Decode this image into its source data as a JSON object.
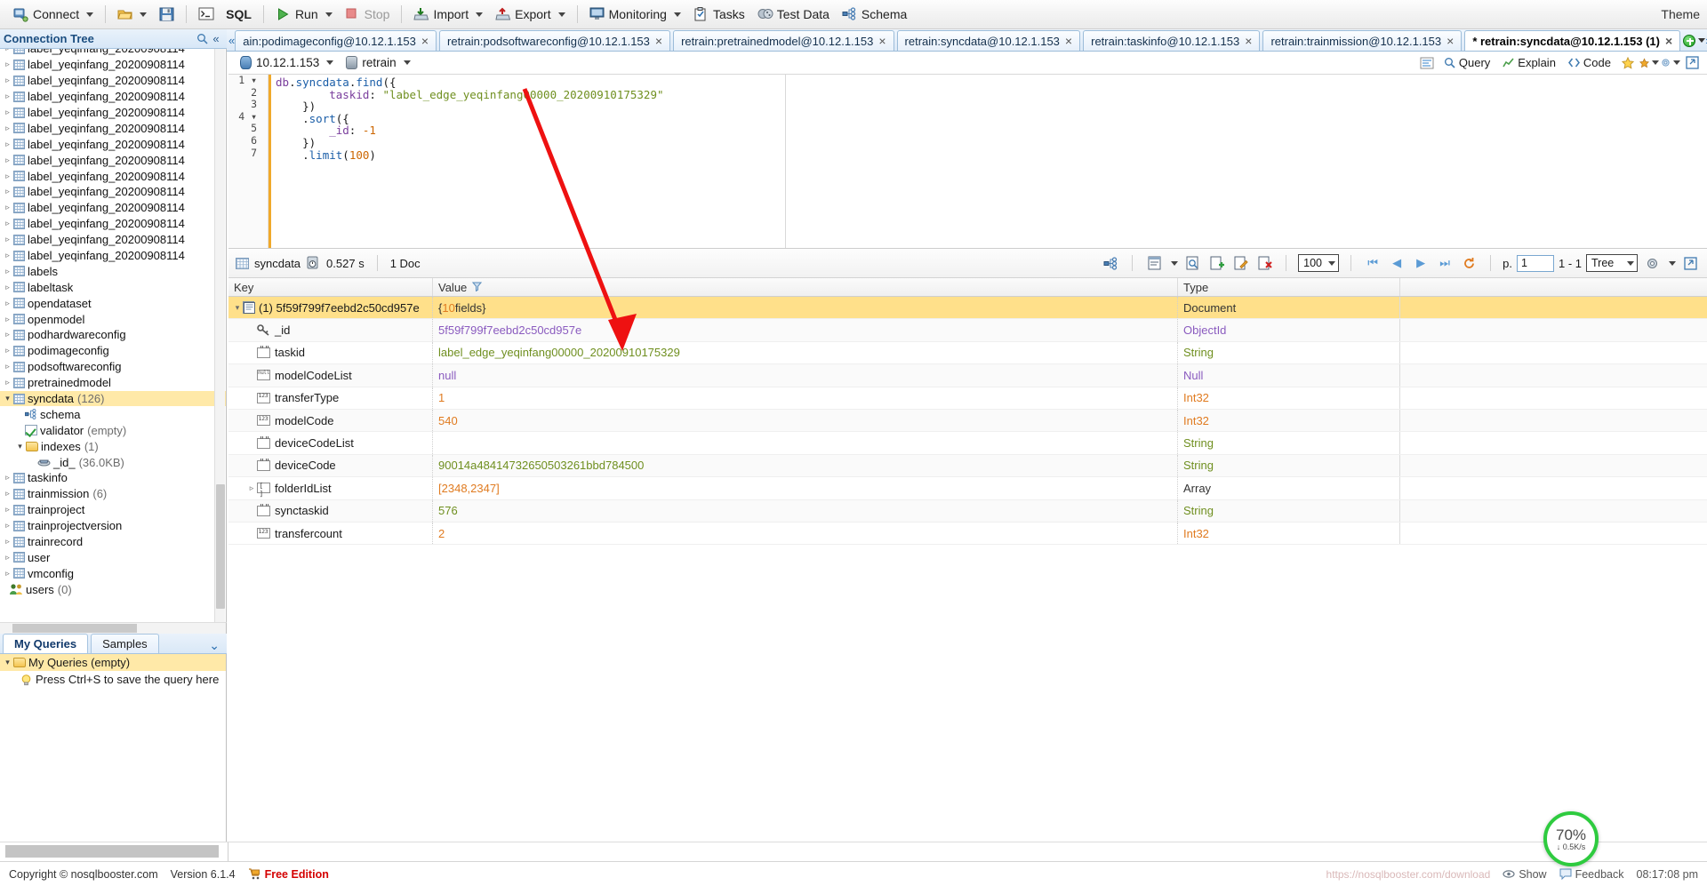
{
  "toolbar": {
    "connect": "Connect",
    "open_label": "",
    "save_label": "",
    "shell_label": "",
    "sql": "SQL",
    "run": "Run",
    "stop": "Stop",
    "import": "Import",
    "export": "Export",
    "monitoring": "Monitoring",
    "tasks": "Tasks",
    "test_data": "Test Data",
    "schema": "Schema",
    "theme": "Theme"
  },
  "sidebar": {
    "title": "Connection Tree",
    "collections": [
      {
        "label": "label_yeqinfang_20200908114",
        "count": "",
        "indent": 1
      },
      {
        "label": "label_yeqinfang_20200908114",
        "count": "",
        "indent": 1
      },
      {
        "label": "label_yeqinfang_20200908114",
        "count": "",
        "indent": 1
      },
      {
        "label": "label_yeqinfang_20200908114",
        "count": "",
        "indent": 1
      },
      {
        "label": "label_yeqinfang_20200908114",
        "count": "",
        "indent": 1
      },
      {
        "label": "label_yeqinfang_20200908114",
        "count": "",
        "indent": 1
      },
      {
        "label": "label_yeqinfang_20200908114",
        "count": "",
        "indent": 1
      },
      {
        "label": "label_yeqinfang_20200908114",
        "count": "",
        "indent": 1
      },
      {
        "label": "label_yeqinfang_20200908114",
        "count": "",
        "indent": 1
      },
      {
        "label": "label_yeqinfang_20200908114",
        "count": "",
        "indent": 1
      },
      {
        "label": "label_yeqinfang_20200908114",
        "count": "",
        "indent": 1
      },
      {
        "label": "label_yeqinfang_20200908114",
        "count": "",
        "indent": 1
      },
      {
        "label": "label_yeqinfang_20200908114",
        "count": "",
        "indent": 1
      },
      {
        "label": "label_yeqinfang_20200908114",
        "count": "",
        "indent": 1
      },
      {
        "label": "labels",
        "count": "",
        "indent": 1
      },
      {
        "label": "labeltask",
        "count": "",
        "indent": 1
      },
      {
        "label": "opendataset",
        "count": "",
        "indent": 1
      },
      {
        "label": "openmodel",
        "count": "",
        "indent": 1
      },
      {
        "label": "podhardwareconfig",
        "count": "",
        "indent": 1
      },
      {
        "label": "podimageconfig",
        "count": "",
        "indent": 1
      },
      {
        "label": "podsoftwareconfig",
        "count": "",
        "indent": 1
      },
      {
        "label": "pretrainedmodel",
        "count": "",
        "indent": 1
      }
    ],
    "selected": {
      "label": "syncdata",
      "count": "(126)"
    },
    "selected_children": [
      {
        "label": "schema",
        "count": "",
        "icon": "schema-icon"
      },
      {
        "label": "validator",
        "count": "(empty)",
        "icon": "validator-icon"
      },
      {
        "label": "indexes",
        "count": "(1)",
        "icon": "folder-icon"
      },
      {
        "label": "_id_",
        "count": "(36.0KB)",
        "icon": "index-icon"
      }
    ],
    "collections_after": [
      {
        "label": "taskinfo",
        "count": ""
      },
      {
        "label": "trainmission",
        "count": "(6)"
      },
      {
        "label": "trainproject",
        "count": ""
      },
      {
        "label": "trainprojectversion",
        "count": ""
      },
      {
        "label": "trainrecord",
        "count": ""
      },
      {
        "label": "user",
        "count": ""
      },
      {
        "label": "vmconfig",
        "count": ""
      }
    ],
    "users_node": {
      "label": "users",
      "count": "(0)"
    }
  },
  "my_queries": {
    "tabs": [
      "My Queries",
      "Samples"
    ],
    "active_tab": "My Queries",
    "root": "My Queries (empty)",
    "hint": "Press Ctrl+S to save the query here"
  },
  "editor_tabs": {
    "items": [
      {
        "label": "ain:podimageconfig@10.12.1.153",
        "active": false
      },
      {
        "label": "retrain:podsoftwareconfig@10.12.1.153",
        "active": false
      },
      {
        "label": "retrain:pretrainedmodel@10.12.1.153",
        "active": false
      },
      {
        "label": "retrain:syncdata@10.12.1.153",
        "active": false
      },
      {
        "label": "retrain:taskinfo@10.12.1.153",
        "active": false
      },
      {
        "label": "retrain:trainmission@10.12.1.153",
        "active": false
      },
      {
        "label": "* retrain:syncdata@10.12.1.153 (1)",
        "active": true
      }
    ]
  },
  "context_bar": {
    "host": "10.12.1.153",
    "database": "retrain",
    "query": "Query",
    "explain": "Explain",
    "code": "Code"
  },
  "code": {
    "lines": [
      {
        "n": "1",
        "fold": "▾",
        "text": "db.syncdata.find({"
      },
      {
        "n": "2",
        "fold": "",
        "text": "        taskid: \"label_edge_yeqinfang00000_20200910175329\""
      },
      {
        "n": "3",
        "fold": "",
        "text": "    })"
      },
      {
        "n": "4",
        "fold": "▾",
        "text": "    .sort({"
      },
      {
        "n": "5",
        "fold": "",
        "text": "        _id: -1"
      },
      {
        "n": "6",
        "fold": "",
        "text": "    })"
      },
      {
        "n": "7",
        "fold": "",
        "text": "    .limit(100)"
      }
    ],
    "taskid_value": "label_edge_yeqinfang00000_20200910175329",
    "sort_value": "-1",
    "limit_value": "100"
  },
  "result_bar": {
    "collection": "syncdata",
    "time": "0.527 s",
    "docs": "1 Doc",
    "page_size": "100",
    "page_label": "p.",
    "page_value": "1",
    "range": "1 - 1",
    "view_mode": "Tree"
  },
  "result_table": {
    "columns": [
      "Key",
      "Value",
      "Type"
    ],
    "rows": [
      {
        "key": "(1) 5f59f799f7eebd2c50cd957e",
        "value": "{10 fields}",
        "type": "Document",
        "icon": "document-icon",
        "level": 0,
        "selected": true,
        "expandable": true,
        "value_class": "v-doc",
        "type_class": "t-plain"
      },
      {
        "key": "_id",
        "value": "5f59f799f7eebd2c50cd957e",
        "type": "ObjectId",
        "icon": "key-icon",
        "level": 1,
        "selected": false,
        "expandable": false,
        "value_class": "v-oid",
        "type_class": "t-oid"
      },
      {
        "key": "taskid",
        "value": "label_edge_yeqinfang00000_20200910175329",
        "type": "String",
        "icon": "string-icon",
        "level": 1,
        "selected": false,
        "expandable": false,
        "value_class": "v-str",
        "type_class": "t-str"
      },
      {
        "key": "modelCodeList",
        "value": "null",
        "type": "Null",
        "icon": "null-icon",
        "level": 1,
        "selected": false,
        "expandable": false,
        "value_class": "v-null",
        "type_class": "t-null"
      },
      {
        "key": "transferType",
        "value": "1",
        "type": "Int32",
        "icon": "int-icon",
        "level": 1,
        "selected": false,
        "expandable": false,
        "value_class": "v-num",
        "type_class": "t-num"
      },
      {
        "key": "modelCode",
        "value": "540",
        "type": "Int32",
        "icon": "int-icon",
        "level": 1,
        "selected": false,
        "expandable": false,
        "value_class": "v-num",
        "type_class": "t-num"
      },
      {
        "key": "deviceCodeList",
        "value": "",
        "type": "String",
        "icon": "string-icon",
        "level": 1,
        "selected": false,
        "expandable": false,
        "value_class": "v-str",
        "type_class": "t-str"
      },
      {
        "key": "deviceCode",
        "value": "90014a48414732650503261bbd784500",
        "type": "String",
        "icon": "string-icon",
        "level": 1,
        "selected": false,
        "expandable": false,
        "value_class": "v-str",
        "type_class": "t-str"
      },
      {
        "key": "folderIdList",
        "value": "[ 2348, 2347 ]",
        "type": "Array",
        "icon": "array-icon",
        "level": 1,
        "selected": false,
        "expandable": true,
        "value_class": "v-num",
        "type_class": "t-plain"
      },
      {
        "key": "synctaskid",
        "value": "576",
        "type": "String",
        "icon": "string-icon",
        "level": 1,
        "selected": false,
        "expandable": false,
        "value_class": "v-str",
        "type_class": "t-str"
      },
      {
        "key": "transfercount",
        "value": "2",
        "type": "Int32",
        "icon": "int-icon",
        "level": 1,
        "selected": false,
        "expandable": false,
        "value_class": "v-num",
        "type_class": "t-num"
      }
    ]
  },
  "status_bar": {
    "copyright": "Copyright ©  nosqlbooster.com",
    "version": "Version 6.1.4",
    "edition": "Free Edition",
    "ghost_url": "https://nosqlbooster.com/download",
    "show_label": "Show",
    "feedback_label": "Feedback",
    "time": "08:17:08 pm"
  },
  "speed_widget": {
    "percent": "70%",
    "rate": "↓ 0.5K/s"
  },
  "colors": {
    "accent": "#2a6fb0",
    "selection": "#ffe08a",
    "string": "#6f8f1f",
    "number": "#e07b20",
    "null": "#8a5bbf",
    "annotation": "#ee1111",
    "free_edition": "#d40000",
    "speed_ring": "#2ecb3f"
  }
}
